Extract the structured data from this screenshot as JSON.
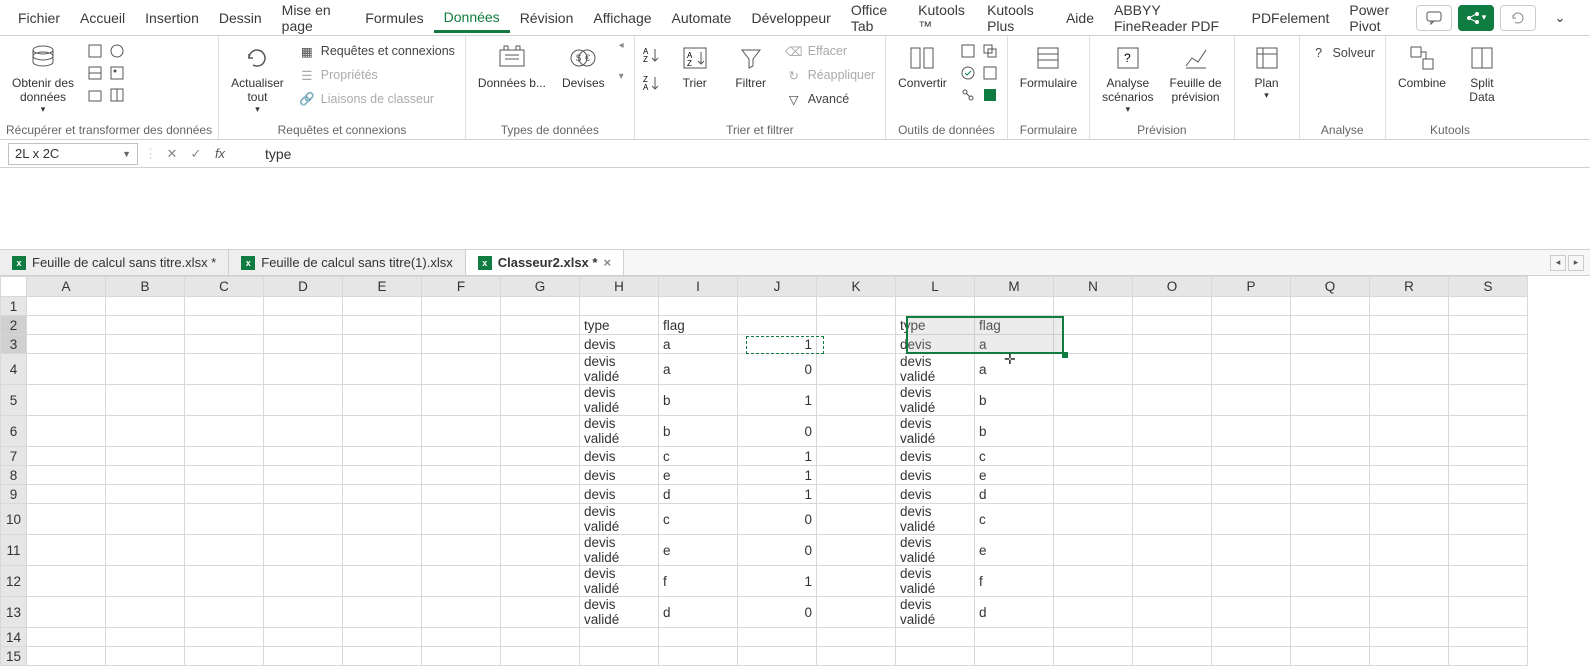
{
  "menu": {
    "tabs": [
      "Fichier",
      "Accueil",
      "Insertion",
      "Dessin",
      "Mise en page",
      "Formules",
      "Données",
      "Révision",
      "Affichage",
      "Automate",
      "Développeur",
      "Office Tab",
      "Kutools ™",
      "Kutools Plus",
      "Aide",
      "ABBYY FineReader PDF",
      "PDFelement",
      "Power Pivot"
    ],
    "active": "Données"
  },
  "ribbon": {
    "group1": {
      "obtenir": "Obtenir des\ndonnées",
      "label": "Récupérer et transformer des données"
    },
    "group2": {
      "actualiser": "Actualiser\ntout",
      "requetes": "Requêtes et connexions",
      "proprietes": "Propriétés",
      "liaisons": "Liaisons de classeur",
      "label": "Requêtes et connexions"
    },
    "group3": {
      "donnees_b": "Données b...",
      "devises": "Devises",
      "label": "Types de données"
    },
    "group4": {
      "trier": "Trier",
      "filtrer": "Filtrer",
      "effacer": "Effacer",
      "reappliquer": "Réappliquer",
      "avance": "Avancé",
      "label": "Trier et filtrer"
    },
    "group5": {
      "convertir": "Convertir",
      "label": "Outils de données"
    },
    "group6": {
      "formulaire": "Formulaire",
      "label": "Formulaire"
    },
    "group7": {
      "analyse": "Analyse\nscénarios",
      "feuille": "Feuille de\nprévision",
      "label": "Prévision"
    },
    "group8": {
      "plan": "Plan",
      "label": ""
    },
    "group9": {
      "solveur": "Solveur",
      "label": "Analyse"
    },
    "group10": {
      "combine": "Combine",
      "split": "Split\nData",
      "label": "Kutools"
    }
  },
  "formula_bar": {
    "name_box": "2L x 2C",
    "formula": "type"
  },
  "workbook_tabs": [
    {
      "name": "Feuille de calcul sans titre.xlsx *",
      "active": false
    },
    {
      "name": "Feuille de calcul sans titre(1).xlsx",
      "active": false
    },
    {
      "name": "Classeur2.xlsx *",
      "active": true
    }
  ],
  "columns": [
    "A",
    "B",
    "C",
    "D",
    "E",
    "F",
    "G",
    "H",
    "I",
    "J",
    "K",
    "L",
    "M",
    "N",
    "O",
    "P",
    "Q",
    "R",
    "S"
  ],
  "rows": [
    1,
    2,
    3,
    4,
    5,
    6,
    7,
    8,
    9,
    10,
    11,
    12,
    13,
    14,
    15
  ],
  "cells": {
    "H2": "type",
    "I2": "flag",
    "H3": "devis",
    "I3": "a",
    "J3": "1",
    "H4": "devis validé",
    "I4": "a",
    "J4": "0",
    "H5": "devis validé",
    "I5": "b",
    "J5": "1",
    "H6": "devis validé",
    "I6": "b",
    "J6": "0",
    "H7": "devis",
    "I7": "c",
    "J7": "1",
    "H8": "devis",
    "I8": "e",
    "J8": "1",
    "H9": "devis",
    "I9": "d",
    "J9": "1",
    "H10": "devis validé",
    "I10": "c",
    "J10": "0",
    "H11": "devis validé",
    "I11": "e",
    "J11": "0",
    "H12": "devis validé",
    "I12": "f",
    "J12": "1",
    "H13": "devis validé",
    "I13": "d",
    "J13": "0",
    "L2": "type",
    "M2": "flag",
    "L3": "devis",
    "M3": "a",
    "L4": "devis validé",
    "M4": "a",
    "L5": "devis validé",
    "M5": "b",
    "L6": "devis validé",
    "M6": "b",
    "L7": "devis",
    "M7": "c",
    "L8": "devis",
    "M8": "e",
    "L9": "devis",
    "M9": "d",
    "L10": "devis validé",
    "M10": "c",
    "L11": "devis validé",
    "M11": "e",
    "L12": "devis validé",
    "M12": "f",
    "L13": "devis validé",
    "M13": "d"
  }
}
